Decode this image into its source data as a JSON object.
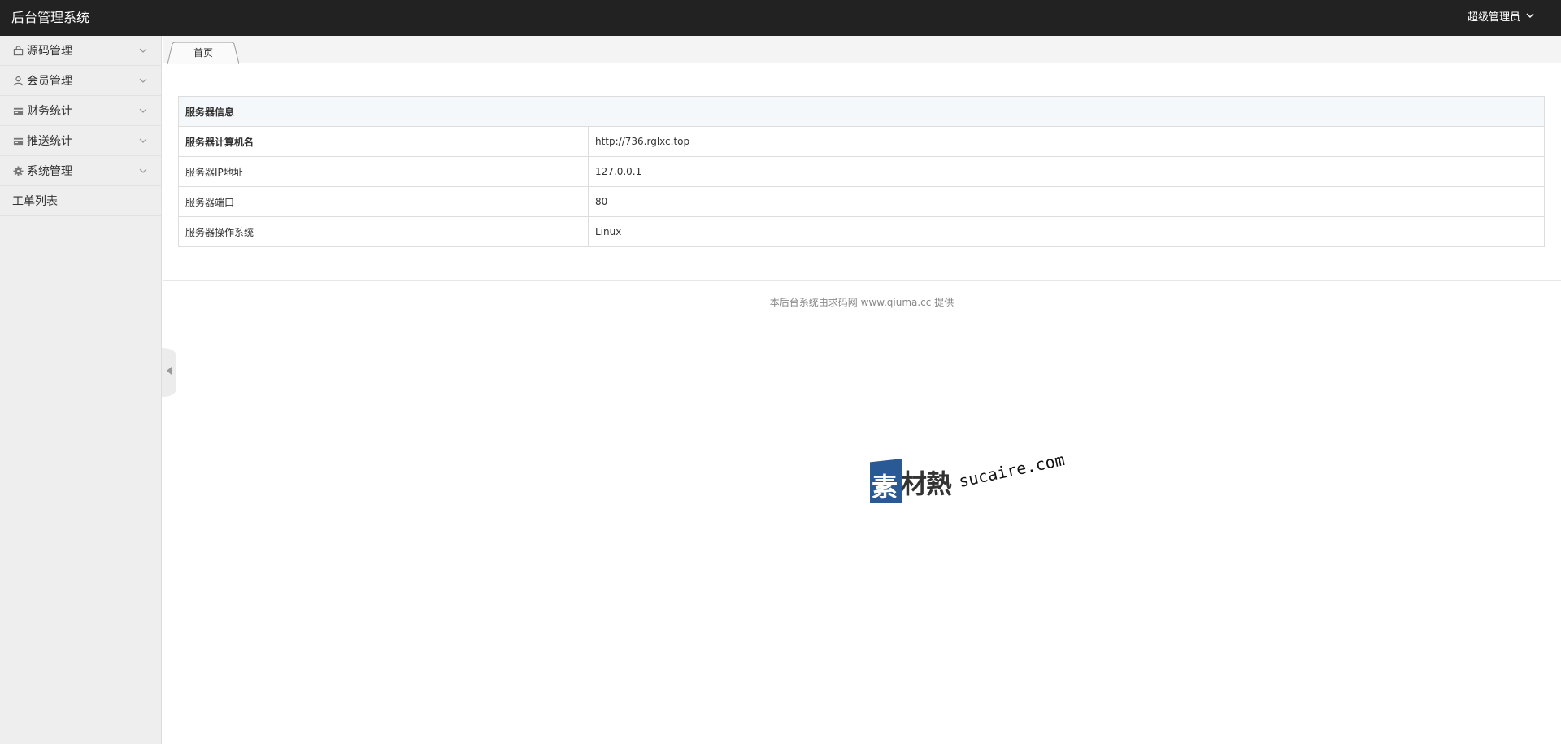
{
  "header": {
    "app_title": "后台管理系统",
    "user_label": "超级管理员"
  },
  "sidebar": {
    "items": [
      {
        "label": "源码管理",
        "icon": "bag-icon"
      },
      {
        "label": "会员管理",
        "icon": "user-icon"
      },
      {
        "label": "财务统计",
        "icon": "card-icon"
      },
      {
        "label": "推送统计",
        "icon": "card-icon"
      },
      {
        "label": "系统管理",
        "icon": "gear-icon"
      },
      {
        "label": "工单列表",
        "icon": ""
      }
    ]
  },
  "tabs": [
    {
      "label": "首页",
      "active": true
    }
  ],
  "server_info": {
    "section_title": "服务器信息",
    "rows": [
      {
        "key": "服务器计算机名",
        "value": "http://736.rglxc.top"
      },
      {
        "key": "服务器IP地址",
        "value": "127.0.0.1"
      },
      {
        "key": "服务器端口",
        "value": "80"
      },
      {
        "key": "服务器操作系统",
        "value": "Linux"
      }
    ]
  },
  "footer": {
    "text": "本后台系统由求码网 www.qiuma.cc 提供"
  },
  "watermark": {
    "mark_char": "素",
    "brand_cn": "材熱",
    "domain": "sucaire.com"
  },
  "colors": {
    "header_bg": "#222222",
    "sidebar_bg": "#eeeeee",
    "table_header_bg": "#f5f8fb",
    "watermark_blue": "#2a5a95"
  }
}
